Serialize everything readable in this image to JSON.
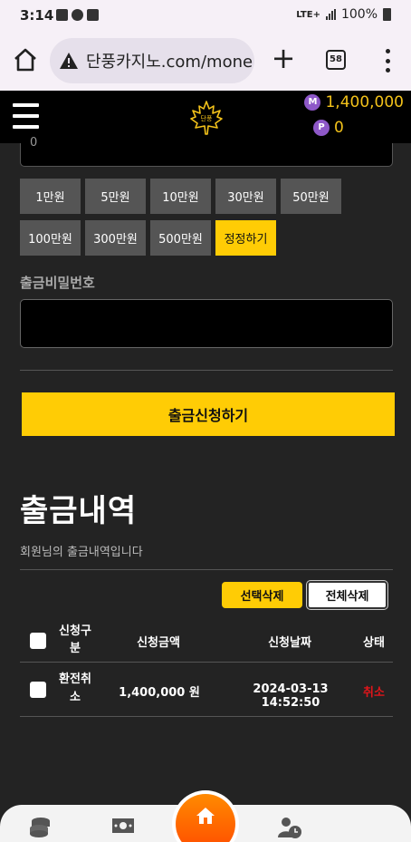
{
  "status_bar": {
    "time": "3:14",
    "network": "LTE+",
    "battery": "100%"
  },
  "browser": {
    "url": "단풍카지노.com/mone",
    "tab_count": "58"
  },
  "header": {
    "money_badge": "M",
    "money_balance": "1,400,000",
    "point_badge": "P",
    "point_balance": "0",
    "logo_text": "단풍"
  },
  "form": {
    "amount_value": "0",
    "quick_amounts_row1": [
      "1만원",
      "5만원",
      "10만원",
      "30만원",
      "50만원"
    ],
    "quick_amounts_row2": [
      "100만원",
      "300만원",
      "500만원"
    ],
    "reset_label": "정정하기",
    "password_label": "출금비밀번호",
    "submit_label": "출금신청하기"
  },
  "history": {
    "title": "출금내역",
    "subtitle": "회원님의 출금내역입니다",
    "select_delete_label": "선택삭제",
    "delete_all_label": "전체삭제",
    "columns": [
      "신청구분",
      "신청금액",
      "신청날짜",
      "상태"
    ],
    "rows": [
      {
        "type": "환전취소",
        "amount": "1,400,000 원",
        "date": "2024-03-13 14:52:50",
        "status": "취소"
      }
    ]
  },
  "colors": {
    "accent": "#ffcc05",
    "background": "#232323",
    "cancel_status": "#e0151a",
    "coin": "#8e58c8"
  }
}
